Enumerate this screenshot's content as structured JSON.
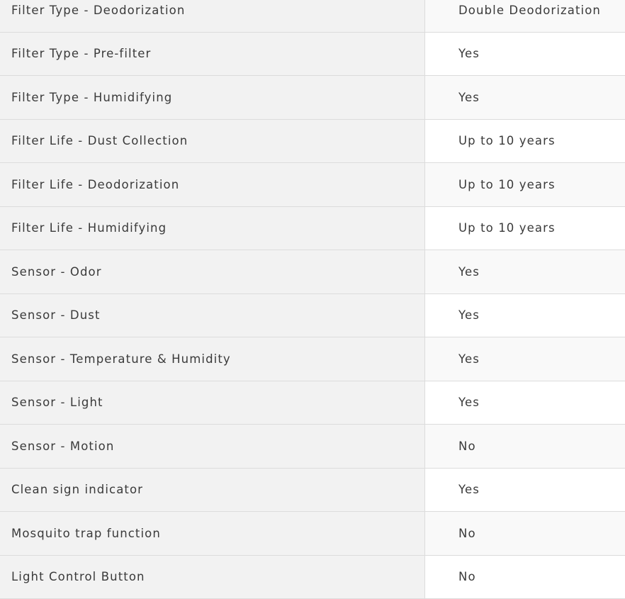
{
  "specs": [
    {
      "label": "Filter Type - Deodorization",
      "value": "Double Deodorization"
    },
    {
      "label": "Filter Type - Pre-filter",
      "value": "Yes"
    },
    {
      "label": "Filter Type - Humidifying",
      "value": "Yes"
    },
    {
      "label": "Filter Life - Dust Collection",
      "value": "Up to 10 years"
    },
    {
      "label": "Filter Life - Deodorization",
      "value": "Up to 10 years"
    },
    {
      "label": "Filter Life - Humidifying",
      "value": "Up to 10 years"
    },
    {
      "label": "Sensor - Odor",
      "value": "Yes"
    },
    {
      "label": "Sensor - Dust",
      "value": "Yes"
    },
    {
      "label": "Sensor - Temperature & Humidity",
      "value": "Yes"
    },
    {
      "label": "Sensor - Light",
      "value": "Yes"
    },
    {
      "label": "Sensor - Motion",
      "value": "No"
    },
    {
      "label": "Clean sign indicator",
      "value": "Yes"
    },
    {
      "label": "Mosquito trap function",
      "value": "No"
    },
    {
      "label": "Light Control Button",
      "value": "No"
    }
  ]
}
